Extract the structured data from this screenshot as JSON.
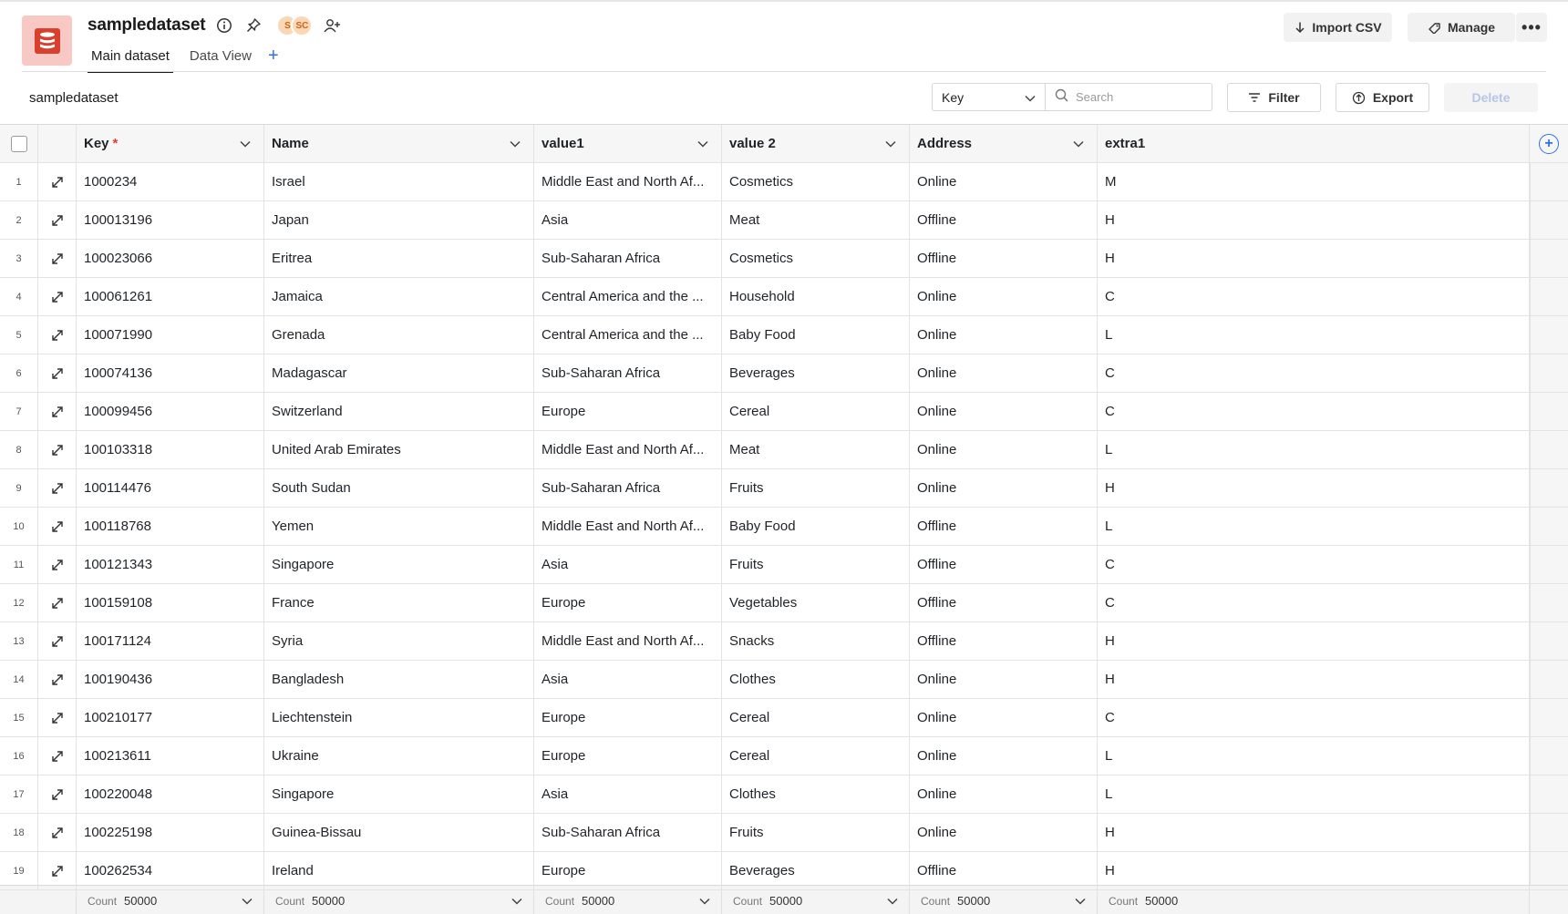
{
  "header": {
    "title": "sampledataset",
    "avatars": [
      "S",
      "SC"
    ],
    "tabs": [
      {
        "label": "Main dataset",
        "active": true
      },
      {
        "label": "Data View",
        "active": false
      }
    ],
    "import_label": "Import CSV",
    "manage_label": "Manage",
    "more_label": "•••"
  },
  "toolbar": {
    "dataset_name": "sampledataset",
    "key_select": "Key",
    "search_placeholder": "Search",
    "filter_label": "Filter",
    "export_label": "Export",
    "delete_label": "Delete"
  },
  "colors": {
    "accent": "#2f6fed",
    "app_icon_bg": "#f7c8c4",
    "app_icon_fg": "#d9412e",
    "required": "#d9412e"
  },
  "table": {
    "columns": [
      {
        "label": "Key",
        "required": true
      },
      {
        "label": "Name",
        "required": false
      },
      {
        "label": "value1",
        "required": false
      },
      {
        "label": "value 2",
        "required": false
      },
      {
        "label": "Address",
        "required": false
      },
      {
        "label": "extra1",
        "required": false
      }
    ],
    "rows": [
      [
        "1",
        "1000234",
        "Israel",
        "Middle East and North Af...",
        "Cosmetics",
        "Online",
        "M"
      ],
      [
        "2",
        "100013196",
        "Japan",
        "Asia",
        "Meat",
        "Offline",
        "H"
      ],
      [
        "3",
        "100023066",
        "Eritrea",
        "Sub-Saharan Africa",
        "Cosmetics",
        "Offline",
        "H"
      ],
      [
        "4",
        "100061261",
        "Jamaica",
        "Central America and the ...",
        "Household",
        "Online",
        "C"
      ],
      [
        "5",
        "100071990",
        "Grenada",
        "Central America and the ...",
        "Baby Food",
        "Online",
        "L"
      ],
      [
        "6",
        "100074136",
        "Madagascar",
        "Sub-Saharan Africa",
        "Beverages",
        "Online",
        "C"
      ],
      [
        "7",
        "100099456",
        "Switzerland",
        "Europe",
        "Cereal",
        "Online",
        "C"
      ],
      [
        "8",
        "100103318",
        "United Arab Emirates",
        "Middle East and North Af...",
        "Meat",
        "Online",
        "L"
      ],
      [
        "9",
        "100114476",
        "South Sudan",
        "Sub-Saharan Africa",
        "Fruits",
        "Online",
        "H"
      ],
      [
        "10",
        "100118768",
        "Yemen",
        "Middle East and North Af...",
        "Baby Food",
        "Offline",
        "L"
      ],
      [
        "11",
        "100121343",
        "Singapore",
        "Asia",
        "Fruits",
        "Offline",
        "C"
      ],
      [
        "12",
        "100159108",
        "France",
        "Europe",
        "Vegetables",
        "Offline",
        "C"
      ],
      [
        "13",
        "100171124",
        "Syria",
        "Middle East and North Af...",
        "Snacks",
        "Offline",
        "H"
      ],
      [
        "14",
        "100190436",
        "Bangladesh",
        "Asia",
        "Clothes",
        "Online",
        "H"
      ],
      [
        "15",
        "100210177",
        "Liechtenstein",
        "Europe",
        "Cereal",
        "Online",
        "C"
      ],
      [
        "16",
        "100213611",
        "Ukraine",
        "Europe",
        "Cereal",
        "Online",
        "L"
      ],
      [
        "17",
        "100220048",
        "Singapore",
        "Asia",
        "Clothes",
        "Online",
        "L"
      ],
      [
        "18",
        "100225198",
        "Guinea-Bissau",
        "Sub-Saharan Africa",
        "Fruits",
        "Online",
        "H"
      ],
      [
        "19",
        "100262534",
        "Ireland",
        "Europe",
        "Beverages",
        "Offline",
        "H"
      ]
    ],
    "footer": [
      {
        "label": "Count",
        "value": "50000",
        "has_dropdown": true
      },
      {
        "label": "Count",
        "value": "50000",
        "has_dropdown": true
      },
      {
        "label": "Count",
        "value": "50000",
        "has_dropdown": true
      },
      {
        "label": "Count",
        "value": "50000",
        "has_dropdown": true
      },
      {
        "label": "Count",
        "value": "50000",
        "has_dropdown": true
      },
      {
        "label": "Count",
        "value": "50000",
        "has_dropdown": false
      }
    ]
  }
}
